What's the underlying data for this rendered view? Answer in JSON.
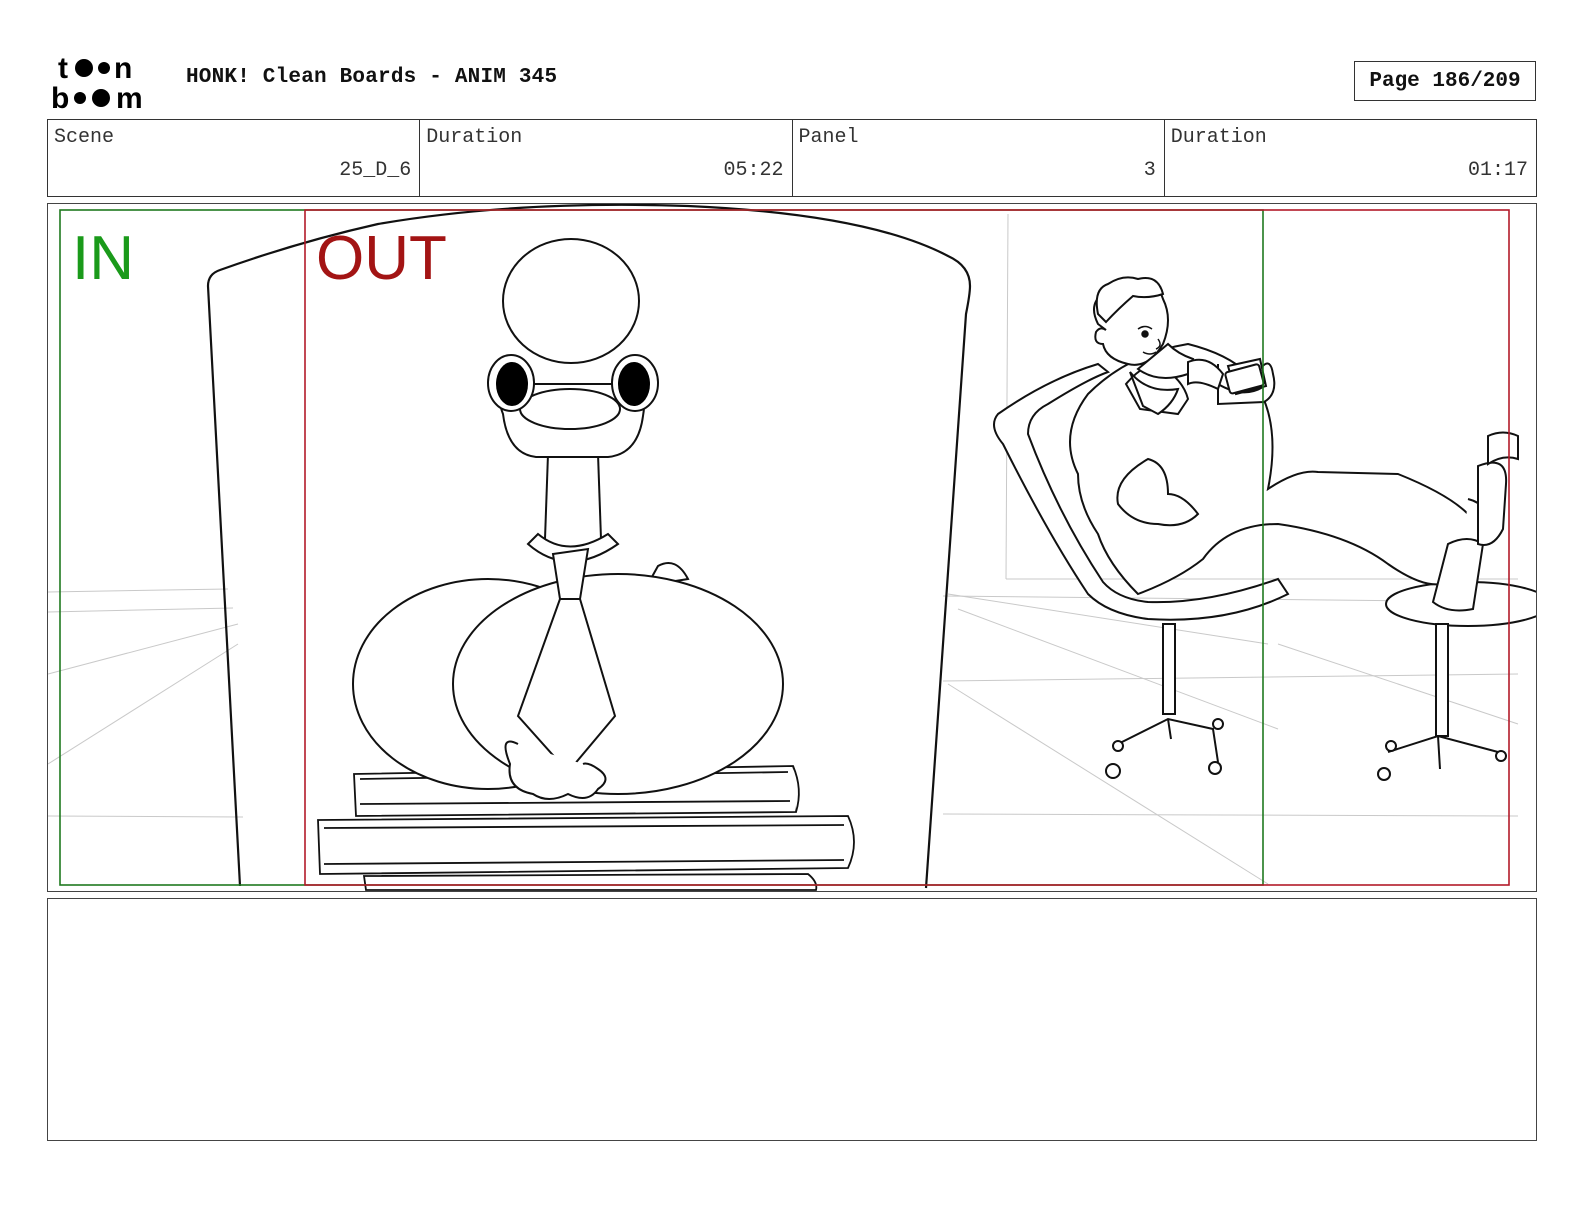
{
  "header": {
    "logo_text_top": "toon",
    "logo_text_bottom": "boom",
    "title": "HONK! Clean Boards - ANIM 345",
    "page_label": "Page 186/209"
  },
  "info": {
    "scene_label": "Scene",
    "scene_value": "25_D_6",
    "scene_duration_label": "Duration",
    "scene_duration_value": "05:22",
    "panel_label": "Panel",
    "panel_value": "3",
    "panel_duration_label": "Duration",
    "panel_duration_value": "01:17"
  },
  "panel": {
    "in_label": "IN",
    "out_label": "OUT",
    "in_color": "#1a9a1a",
    "out_color": "#a31414"
  },
  "notes": {
    "text": ""
  }
}
